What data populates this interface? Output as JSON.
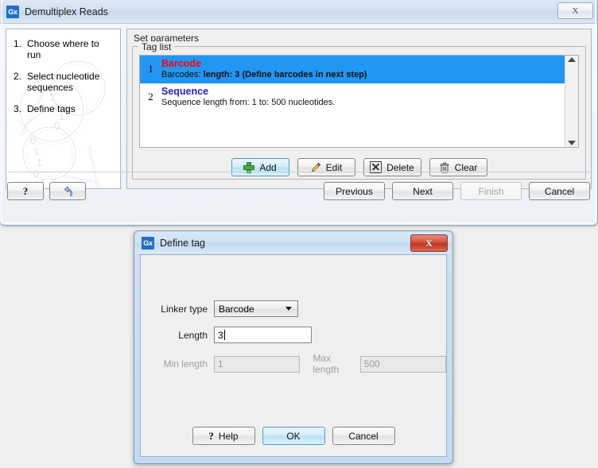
{
  "wizard": {
    "title": "Demultiplex Reads",
    "app_icon": "Gx",
    "close_label": "X",
    "steps": [
      {
        "num": "1.",
        "label": "Choose where to run"
      },
      {
        "num": "2.",
        "label": "Select nucleotide sequences"
      },
      {
        "num": "3.",
        "label": "Define tags"
      }
    ],
    "section_title": "Set parameters",
    "group_legend": "Tag list",
    "tags": [
      {
        "num": "1",
        "title": "Barcode",
        "title_color": "#ff0000",
        "desc_plain": "Barcodes: ",
        "desc_bold": "length: 3 (Define barcodes in next step)",
        "selected": true
      },
      {
        "num": "2",
        "title": "Sequence",
        "title_color": "#2222cc",
        "desc_plain": "Sequence length from: 1 to: 500 nucleotides.",
        "desc_bold": "",
        "selected": false
      }
    ],
    "list_buttons": [
      {
        "label": "Add",
        "icon": "plus-icon",
        "state": "primary"
      },
      {
        "label": "Edit",
        "icon": "pencil-icon",
        "state": "normal"
      },
      {
        "label": "Delete",
        "icon": "delete-box-icon",
        "state": "normal"
      },
      {
        "label": "Clear",
        "icon": "trash-icon",
        "state": "normal"
      }
    ],
    "footer_left": [
      {
        "label": "?",
        "name": "help-button"
      },
      {
        "label": "",
        "name": "reset-button",
        "icon": "undo-arrow-icon"
      }
    ],
    "footer_right": [
      {
        "label": "Previous",
        "state": "normal"
      },
      {
        "label": "Next",
        "state": "normal"
      },
      {
        "label": "Finish",
        "state": "disabled"
      },
      {
        "label": "Cancel",
        "state": "normal"
      }
    ],
    "scrollbar": {
      "up": "▲",
      "down": "▼"
    },
    "selection_color": "#2196f3"
  },
  "dialog": {
    "title": "Define tag",
    "app_icon": "Gx",
    "close_label": "X",
    "close_color": "#c33a24",
    "fields": {
      "linker_type_label": "Linker type",
      "linker_type_value": "Barcode",
      "length_label": "Length",
      "length_value": "3",
      "min_length_label": "Min length",
      "min_length_value": "1",
      "max_length_label": "Max length",
      "max_length_value": "500"
    },
    "buttons": [
      {
        "label": "Help",
        "state": "normal",
        "icon": "question-icon"
      },
      {
        "label": "OK",
        "state": "primary",
        "icon": ""
      },
      {
        "label": "Cancel",
        "state": "normal",
        "icon": ""
      }
    ]
  }
}
